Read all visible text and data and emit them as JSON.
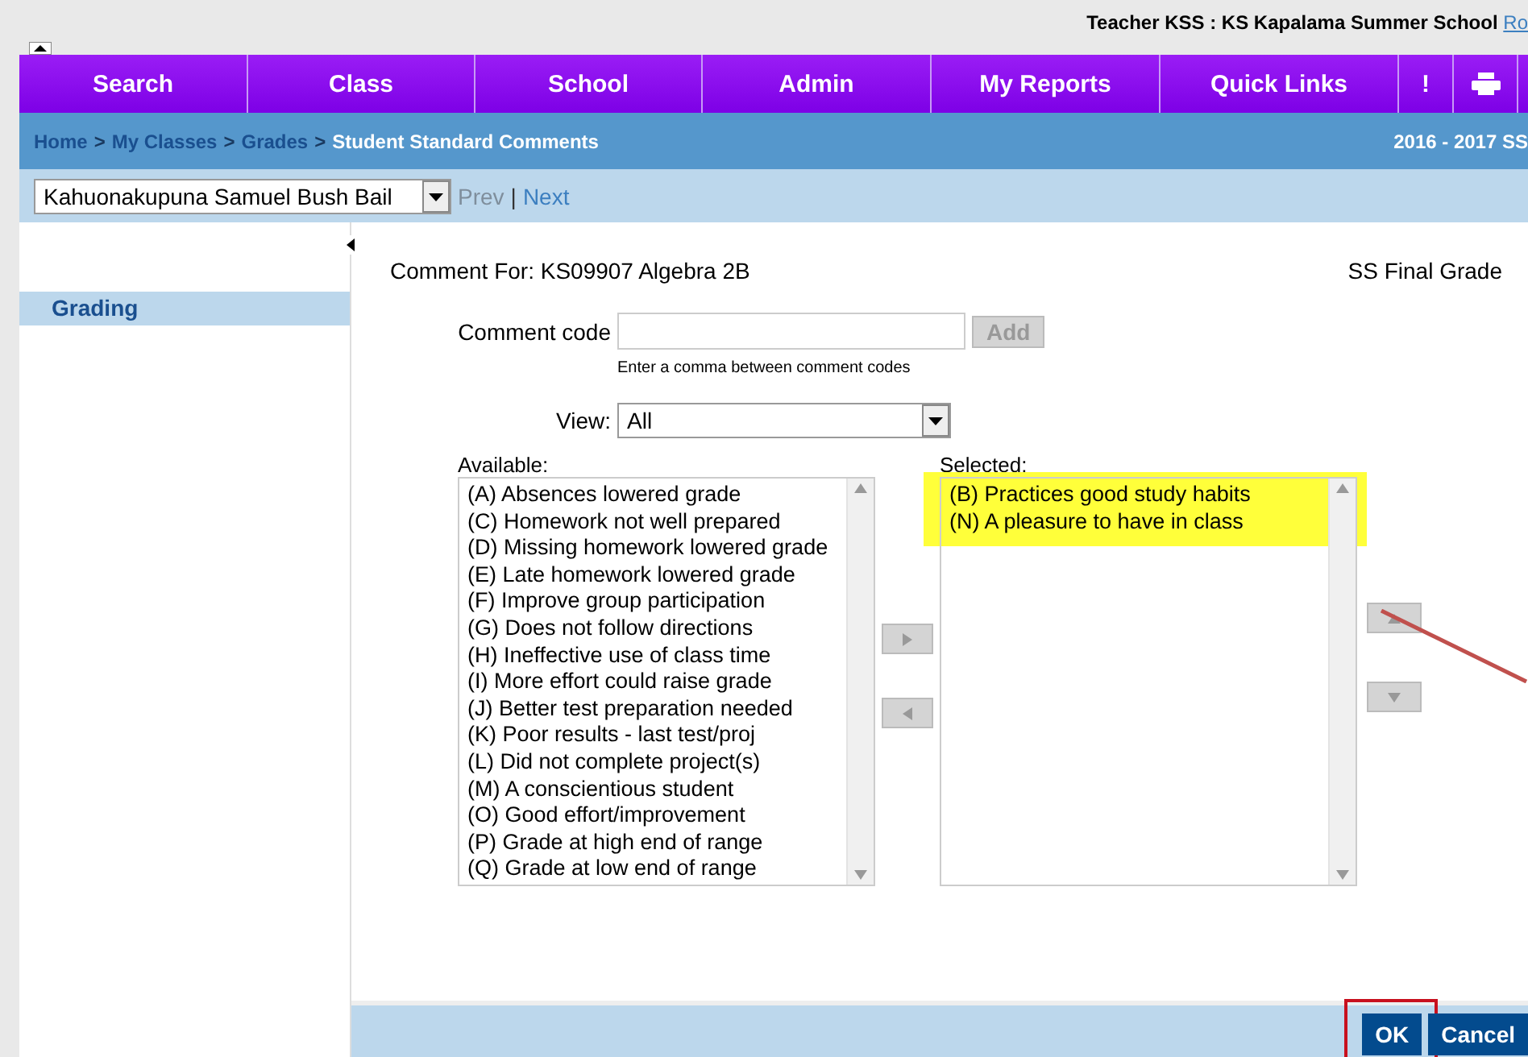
{
  "header": {
    "user_text": "Teacher KSS : KS Kapalama Summer School",
    "link": "Ro"
  },
  "nav": [
    {
      "label": "Search",
      "kind": "text"
    },
    {
      "label": "Class",
      "kind": "text"
    },
    {
      "label": "School",
      "kind": "text"
    },
    {
      "label": "Admin",
      "kind": "text"
    },
    {
      "label": "My Reports",
      "kind": "text"
    },
    {
      "label": "Quick Links",
      "kind": "text"
    },
    {
      "label": "!",
      "kind": "text"
    },
    {
      "kind": "print"
    }
  ],
  "breadcrumb": {
    "links": [
      "Home",
      "My Classes",
      "Grades"
    ],
    "separator": ">",
    "current": "Student Standard Comments",
    "term": "2016 - 2017 SS"
  },
  "student_bar": {
    "student": "Kahuonakupuna Samuel Bush Bail",
    "prev": {
      "label": "Prev",
      "disabled": true
    },
    "divider": "|",
    "next": {
      "label": "Next",
      "disabled": false
    }
  },
  "sidebar": {
    "items": [
      {
        "label": "Grading",
        "selected": true
      }
    ]
  },
  "form": {
    "comment_for": "Comment For: KS09907 Algebra 2B",
    "grade": "SS Final Grade",
    "code_label": "Comment code",
    "add": {
      "label": "Add",
      "disabled": true
    },
    "hint": "Enter a comma between comment codes",
    "view_label": "View:",
    "view_value": "All",
    "available_label": "Available:",
    "available": [
      "(A) Absences lowered grade",
      "(C) Homework not well prepared",
      "(D) Missing homework lowered grade",
      "(E) Late homework lowered grade",
      "(F) Improve group participation",
      "(G) Does not follow directions",
      "(H) Ineffective use of class time",
      "(I) More effort could raise grade",
      "(J) Better test preparation needed",
      "(K) Poor results - last test/proj",
      "(L) Did not complete project(s)",
      "(M) A conscientious student",
      "(O) Good effort/improvement",
      "(P) Grade at high end of range",
      "(Q) Grade at low end of range"
    ],
    "selected_label": "Selected:",
    "selected": [
      "(B) Practices good study habits",
      "(N) A pleasure to have in class"
    ],
    "highlighted": true
  },
  "footer": {
    "buttons": [
      {
        "label": "OK",
        "circled": true
      },
      {
        "label": "Cancel",
        "circled": false
      }
    ]
  }
}
